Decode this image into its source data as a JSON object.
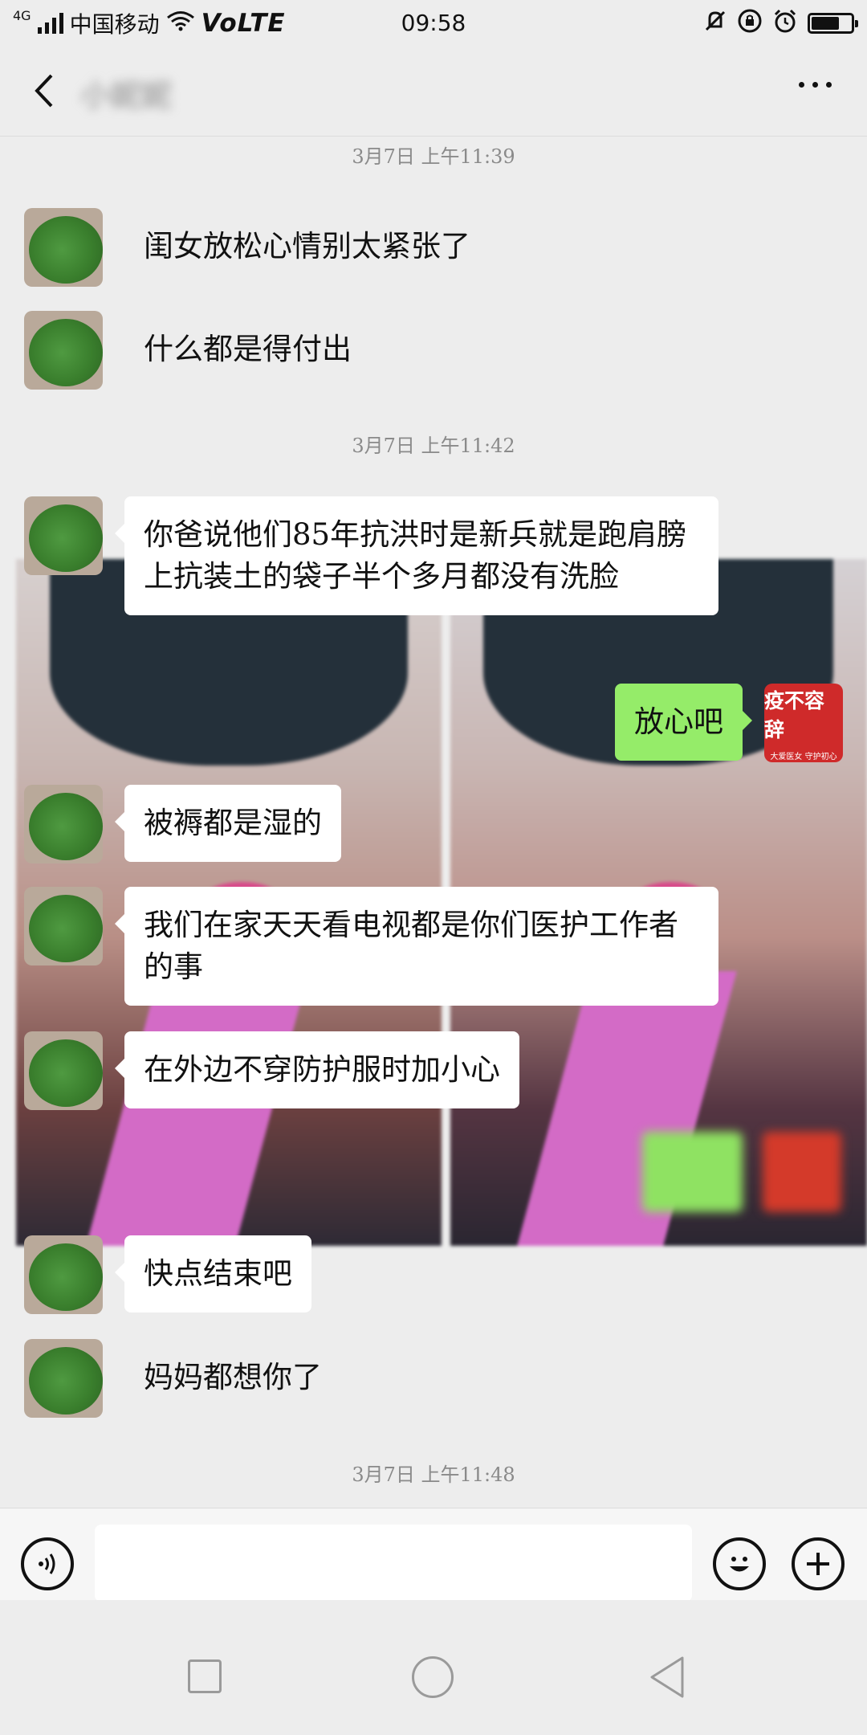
{
  "status_bar": {
    "network": "4G",
    "carrier": "中国移动",
    "volte": "VoLTE",
    "time": "09:58",
    "battery_level": 0.7
  },
  "header": {
    "contact_name": "小妮妮",
    "back_icon": "chevron-left-icon",
    "more_icon": "more-dots-icon"
  },
  "timestamps": [
    "3月7日 上午11:39",
    "3月7日 上午11:42",
    "3月7日 上午11:48"
  ],
  "messages": [
    {
      "text": "闺女放松心情别太紧张了"
    },
    {
      "text": "什么都是得付出"
    },
    {
      "text": "你爸说他们85年抗洪时是新兵就是跑肩膀上抗装土的袋子半个多月都没有洗脸"
    },
    {
      "text": "放心吧"
    },
    {
      "text": "被褥都是湿的"
    },
    {
      "text": "我们在家天天看电视都是你们医护工作者的事"
    },
    {
      "text": "在外边不穿防护服时加小心"
    },
    {
      "text": "快点结束吧"
    },
    {
      "text": "妈妈都想你了"
    }
  ],
  "self_avatar": {
    "line1": "疫不容辞",
    "line2": "大爱医女 守护初心"
  },
  "input_bar": {
    "voice_icon": "voice-icon",
    "emoji_icon": "emoji-icon",
    "plus_icon": "plus-icon"
  },
  "colors": {
    "background": "#ededed",
    "self_bubble": "#95ec69",
    "other_bubble": "#ffffff",
    "self_avatar": "#cf2a2a"
  }
}
